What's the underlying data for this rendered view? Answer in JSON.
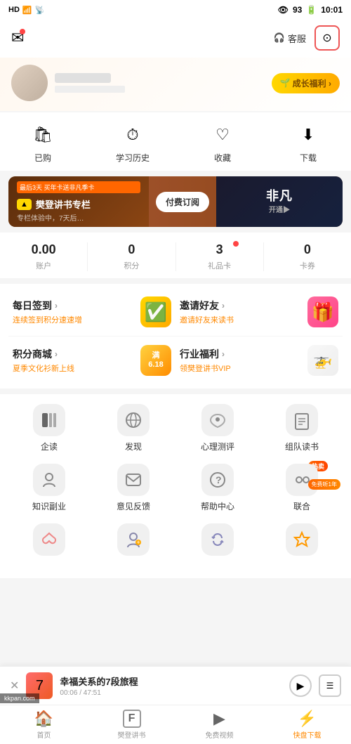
{
  "statusBar": {
    "left": "HD 4G",
    "battery": "93",
    "time": "10:01"
  },
  "header": {
    "kefu": "客服",
    "settings": "⚙"
  },
  "profile": {
    "growthBtn": "成长福利 ›"
  },
  "quickIcons": [
    {
      "id": "yigou",
      "icon": "🛍",
      "label": "已购"
    },
    {
      "id": "xuexilishi",
      "icon": "⏱",
      "label": "学习历史"
    },
    {
      "id": "shoucang",
      "icon": "♡",
      "label": "收藏"
    },
    {
      "id": "xiazai",
      "icon": "⬇",
      "label": "下载"
    }
  ],
  "promo": {
    "tag": "最后3天 买年卡送非凡季卡",
    "title": "樊登讲书专栏",
    "sub": "专栏体验中，7天后…",
    "btn": "付费订阅",
    "rightTitle": "非凡",
    "rightSub": "开通▶"
  },
  "stats": [
    {
      "value": "0.00",
      "label": "账户"
    },
    {
      "value": "0",
      "label": "积分"
    },
    {
      "value": "3",
      "label": "礼品卡",
      "dot": true
    },
    {
      "value": "0",
      "label": "卡券"
    }
  ],
  "actionCards": [
    {
      "left": {
        "title": "每日签到",
        "arrow": "›",
        "sub": "连续签到积分速速增",
        "iconType": "yellow",
        "icon": "✅"
      },
      "right": {
        "title": "邀请好友",
        "arrow": "›",
        "sub": "邀请好友来读书",
        "iconType": "pink",
        "icon": "🎁"
      }
    },
    {
      "left": {
        "title": "积分商城",
        "arrow": "›",
        "sub": "夏季文化衫新上线",
        "iconType": "blue",
        "icon": "🏅"
      },
      "right": {
        "title": "行业福利",
        "arrow": "›",
        "sub": "领樊登讲书VIP",
        "iconType": "green",
        "icon": "🚁"
      }
    }
  ],
  "features": [
    [
      {
        "id": "qidu",
        "icon": "🏢",
        "label": "企读",
        "badge": null
      },
      {
        "id": "faxian",
        "icon": "🪐",
        "label": "发现",
        "badge": null
      },
      {
        "id": "xinli",
        "icon": "🧠",
        "label": "心理测评",
        "badge": null
      },
      {
        "id": "zudu",
        "icon": "📖",
        "label": "组队读书",
        "badge": null
      }
    ],
    [
      {
        "id": "zhishi",
        "icon": "🎓",
        "label": "知识副业",
        "badge": null
      },
      {
        "id": "yijian",
        "icon": "✉",
        "label": "意见反馈",
        "badge": null
      },
      {
        "id": "bangzhu",
        "icon": "❓",
        "label": "帮助中心",
        "badge": null
      },
      {
        "id": "lianhe",
        "icon": "🤝",
        "label": "联合",
        "badge": "热卖",
        "freebadge": "免费听1年"
      }
    ],
    [
      {
        "id": "item9",
        "icon": "🌸",
        "label": "",
        "badge": null
      },
      {
        "id": "item10",
        "icon": "👤",
        "label": "",
        "badge": null
      },
      {
        "id": "item11",
        "icon": "🔄",
        "label": "",
        "badge": null
      },
      {
        "id": "item12",
        "icon": "⭐",
        "label": "",
        "badge": null
      }
    ]
  ],
  "player": {
    "close": "✕",
    "title": "幸福关系的7段旅程",
    "time": "00:06 / 47:51"
  },
  "bottomNav": [
    {
      "id": "home",
      "icon": "🏠",
      "label": "首页",
      "active": false
    },
    {
      "id": "fandeng",
      "icon": "F",
      "label": "樊登讲书",
      "active": false
    },
    {
      "id": "video",
      "icon": "▶",
      "label": "免费视频",
      "active": false
    },
    {
      "id": "kuaipan",
      "icon": "⚡",
      "label": "快盘下载",
      "active": true
    }
  ],
  "watermark": "kkpan.com"
}
